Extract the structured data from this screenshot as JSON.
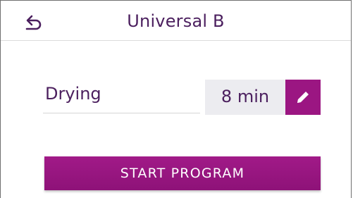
{
  "header": {
    "title": "Universal B",
    "back_icon": "back-arrow-icon"
  },
  "setting": {
    "label": "Drying",
    "value": "8 min",
    "edit_icon": "pencil-icon"
  },
  "actions": {
    "start_label": "START PROGRAM"
  },
  "colors": {
    "accent": "#9b1682",
    "text": "#4b1f5e",
    "value_bg": "#ececf0"
  }
}
